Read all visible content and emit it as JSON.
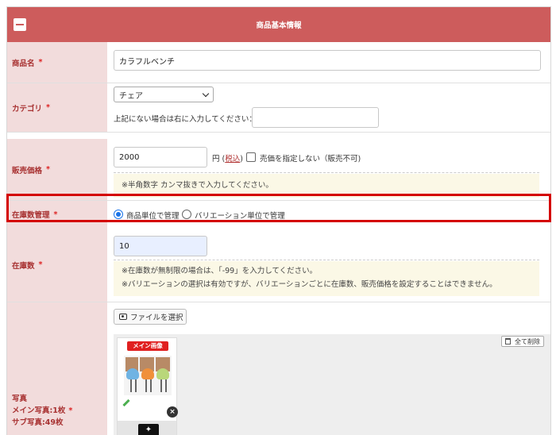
{
  "header": {
    "title": "商品基本情報"
  },
  "required_mark": "*",
  "product_name": {
    "label": "商品名",
    "value": "カラフルベンチ"
  },
  "category": {
    "label": "カテゴリ",
    "selected": "チェア",
    "other_prompt": "上記にない場合は右に入力してください：",
    "other_value": ""
  },
  "price": {
    "label": "販売価格",
    "value": "2000",
    "unit": "円",
    "tax_open": "(",
    "tax_link": "税込",
    "tax_close": ")",
    "no_price_label": "売価を指定しない（販売不可)",
    "note": "※半角数字 カンマ抜きで入力してください。"
  },
  "stock_mgmt": {
    "label": "在庫数管理",
    "option_product": "商品単位で管理",
    "option_variation": "バリエーション単位で管理",
    "selected": "option_product"
  },
  "stock": {
    "label": "在庫数",
    "value": "10",
    "note_line1": "※在庫数が無制限の場合は、「-99」を入力してください。",
    "note_line2": "※バリエーションの選択は有効ですが、バリエーションごとに在庫数、販売価格を設定することはできません。"
  },
  "photo": {
    "label": "写真",
    "main_count": "メイン写真:1枚",
    "sub_count": "サブ写真:49枚",
    "file_button": "ファイルを選択",
    "delete_all": "全て削除",
    "main_badge": "メイン画像"
  },
  "colors": {
    "header_bg": "#cd5c5c",
    "label_bg": "#f2dcdc",
    "label_text": "#a83232",
    "highlight_border": "#d40000",
    "note_bg": "#fbf8e6",
    "radio_on": "#1a73e8"
  }
}
